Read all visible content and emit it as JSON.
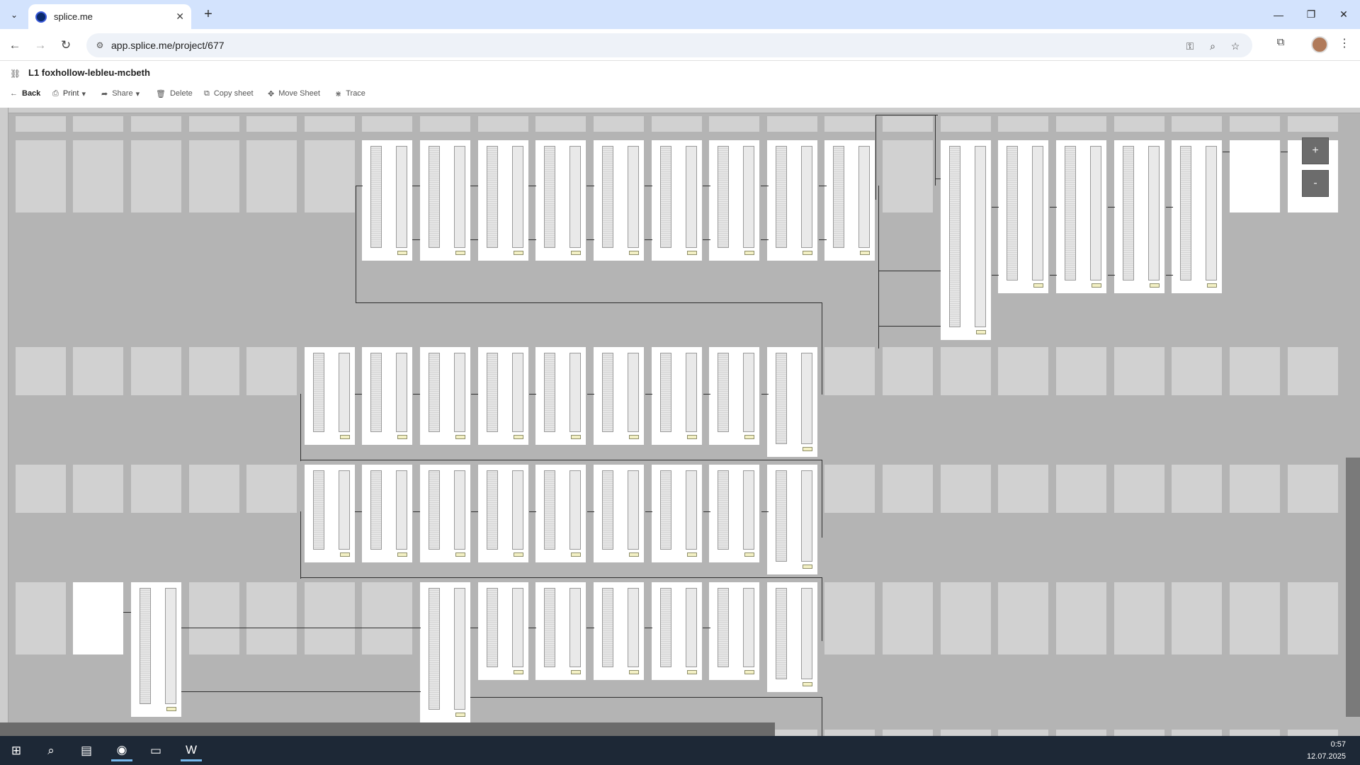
{
  "browser": {
    "tab_title": "splice.me",
    "url": "app.splice.me/project/677",
    "icons": {
      "tab_search": "chevron-down-icon",
      "new_tab": "plus-icon",
      "back": "arrow-left-icon",
      "forward": "arrow-right-icon",
      "reload": "reload-icon",
      "site_info": "tune-icon",
      "password": "key-icon",
      "zoom": "zoom-icon",
      "bookmark": "star-icon",
      "extensions": "puzzle-icon",
      "menu": "kebab-icon"
    }
  },
  "app": {
    "title": "L1 foxhollow-lebleu-mcbeth",
    "toolbar": {
      "back": "Back",
      "print": "Print",
      "share": "Share",
      "delete": "Delete",
      "copy_sheet": "Copy sheet",
      "move_sheet": "Move Sheet",
      "trace": "Trace"
    },
    "zoom_in": "+",
    "zoom_out": "-"
  },
  "taskbar": {
    "time": "0:57",
    "date": "12.07.2025"
  },
  "colors": {
    "canvas_bg": "#b4b4b4",
    "ghost_sheet": "#d1d1d1",
    "sheet": "#ffffff",
    "tabstrip": "#d3e3fd",
    "taskbar": "#1d2836",
    "label_yellow": "#f3f0c4"
  }
}
